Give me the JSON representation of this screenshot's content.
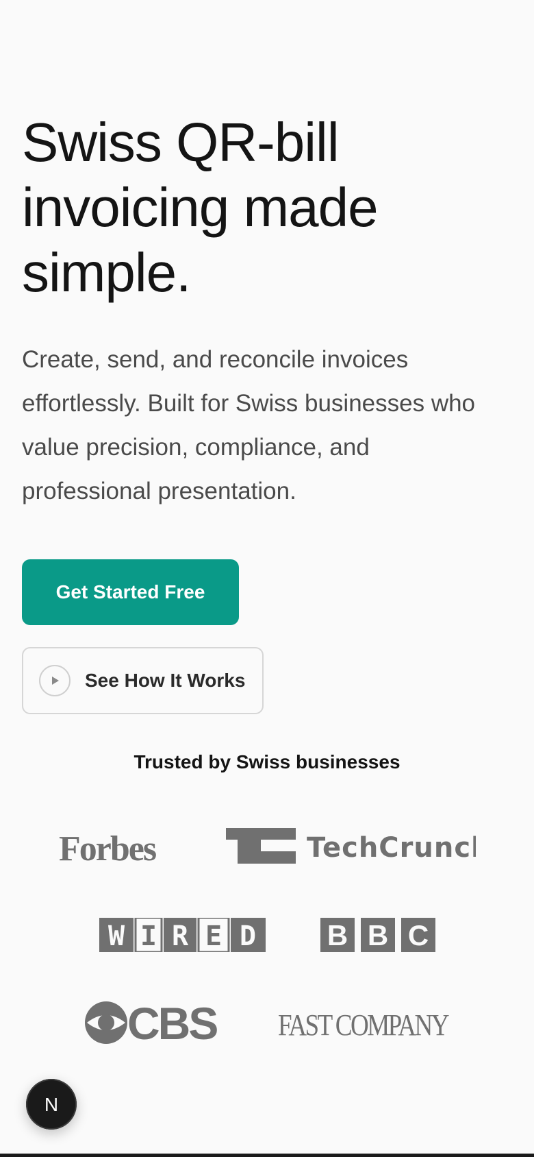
{
  "hero": {
    "title": "Swiss QR-bill invoicing made simple.",
    "subtitle": "Create, send, and reconcile invoices effortlessly. Built for Swiss businesses who value precision, compliance, and professional presentation."
  },
  "actions": {
    "primary_label": "Get Started Free",
    "secondary_label": "See How It Works",
    "secondary_icon": "play-icon"
  },
  "trusted": {
    "heading": "Trusted by Swiss businesses",
    "logos": [
      {
        "name": "Forbes",
        "icon": "forbes-logo"
      },
      {
        "name": "TechCrunch",
        "icon": "techcrunch-logo"
      },
      {
        "name": "WIRED",
        "icon": "wired-logo"
      },
      {
        "name": "BBC",
        "icon": "bbc-logo"
      },
      {
        "name": "CBS",
        "icon": "cbs-logo"
      },
      {
        "name": "FAST COMPANY",
        "icon": "fastcompany-logo"
      }
    ]
  },
  "dev_indicator": {
    "icon": "nextjs-icon",
    "letter": "N"
  },
  "colors": {
    "background": "#fafafa",
    "primary": "#0a9a88",
    "text": "#141414",
    "muted_text": "#4a4a4a",
    "logo_gray": "#707070"
  }
}
